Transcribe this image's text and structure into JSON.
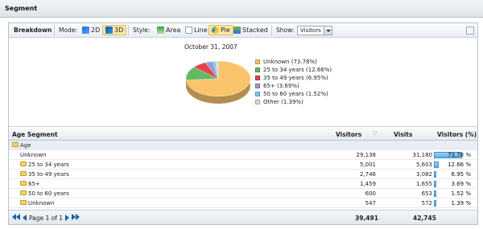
{
  "header": {
    "title": "Segment"
  },
  "toolbar": {
    "breakdown": "Breakdown",
    "mode_label": "Mode:",
    "mode_2d": "2D",
    "mode_3d": "3D",
    "style_label": "Style:",
    "style_area": "Area",
    "style_line": "Line",
    "style_pie": "Pie",
    "style_stacked": "Stacked",
    "show_label": "Show:",
    "show_value": "Visitors"
  },
  "chart_data": {
    "type": "pie",
    "title": "October 31, 2007",
    "series": [
      {
        "name": "Unknown (73.78%)",
        "value": 73.78,
        "color": "#f9c46b"
      },
      {
        "name": "25 to 34 years (12.66%)",
        "value": 12.66,
        "color": "#63b963"
      },
      {
        "name": "35 to 49 years (6.95%)",
        "value": 6.95,
        "color": "#e8434a"
      },
      {
        "name": "65+ (3.69%)",
        "value": 3.69,
        "color": "#9a9ad6"
      },
      {
        "name": "50 to 60 years (1.52%)",
        "value": 1.52,
        "color": "#7fc6e8"
      },
      {
        "name": "Other (1.39%)",
        "value": 1.39,
        "color": "#d9d9d9"
      }
    ]
  },
  "grid": {
    "headers": {
      "segment": "Age Segment",
      "visitors": "Visitors",
      "visits": "Visits",
      "pct": "Visitors (%)"
    },
    "group": "Age",
    "rows": [
      {
        "name": "Unknown",
        "visitors": "29,138",
        "visits": "31,180",
        "pct": "73.78 %",
        "frac": 0.7378,
        "folder": false
      },
      {
        "name": "25 to 34 years",
        "visitors": "5,001",
        "visits": "5,603",
        "pct": "12.66 %",
        "frac": 0.1266,
        "folder": true
      },
      {
        "name": "35 to 49 years",
        "visitors": "2,746",
        "visits": "3,082",
        "pct": "6.95 %",
        "frac": 0.0695,
        "folder": true
      },
      {
        "name": "65+",
        "visitors": "1,459",
        "visits": "1,655",
        "pct": "3.69 %",
        "frac": 0.0369,
        "folder": true
      },
      {
        "name": "50 to 60 years",
        "visitors": "600",
        "visits": "653",
        "pct": "1.52 %",
        "frac": 0.0152,
        "folder": true
      },
      {
        "name": "Unknown",
        "visitors": "547",
        "visits": "572",
        "pct": "1.39 %",
        "frac": 0.0139,
        "folder": true
      }
    ]
  },
  "footer": {
    "page_text": "Page 1 of 1",
    "total_visitors": "39,491",
    "total_visits": "42,745"
  }
}
